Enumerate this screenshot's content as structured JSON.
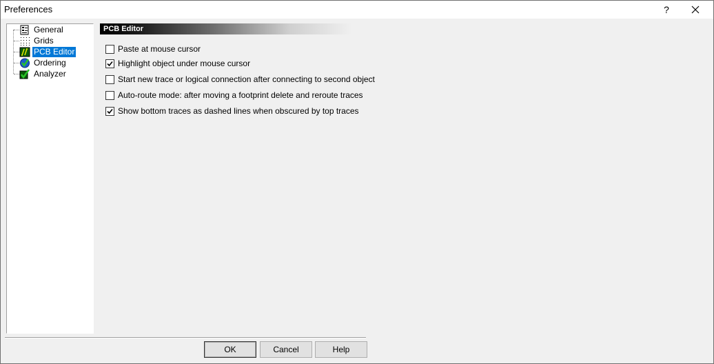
{
  "window": {
    "title": "Preferences",
    "help_label": "?"
  },
  "tree": {
    "items": [
      {
        "label": "General",
        "icon": "general-settings-icon"
      },
      {
        "label": "Grids",
        "icon": "grid-icon"
      },
      {
        "label": "PCB Editor",
        "icon": "pcb-editor-icon",
        "selected": true
      },
      {
        "label": "Ordering",
        "icon": "ordering-check-icon"
      },
      {
        "label": "Analyzer",
        "icon": "analyzer-check-icon"
      }
    ]
  },
  "panel": {
    "header": "PCB Editor",
    "options": [
      {
        "label": "Paste at mouse cursor",
        "checked": false
      },
      {
        "label": "Highlight object under mouse cursor",
        "checked": true
      },
      {
        "label": "Start new trace or logical connection after connecting to second object",
        "checked": false
      },
      {
        "label": "Auto-route mode: after moving a footprint delete and reroute traces",
        "checked": false
      },
      {
        "label": "Show bottom traces as dashed lines when obscured by top traces",
        "checked": true
      }
    ]
  },
  "buttons": {
    "ok": "OK",
    "cancel": "Cancel",
    "help": "Help"
  },
  "colors": {
    "selection": "#0078d7",
    "background": "#f0f0f0"
  }
}
